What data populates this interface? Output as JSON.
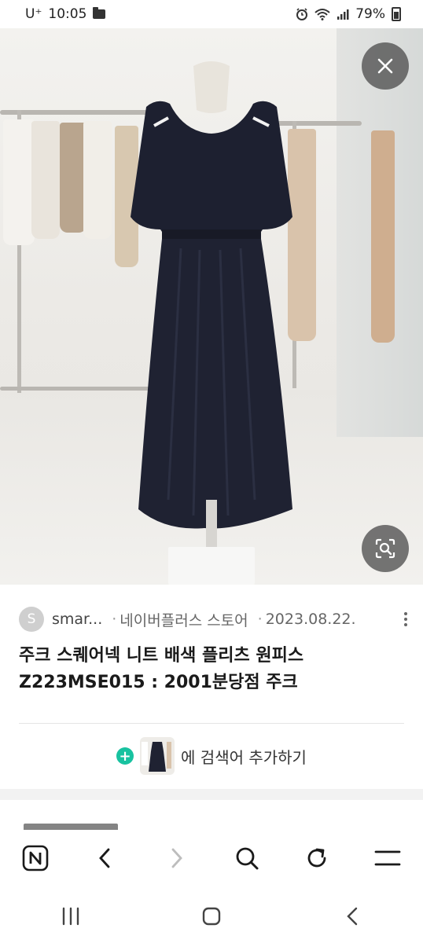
{
  "status_bar": {
    "carrier": "U⁺",
    "time": "10:05",
    "battery": "79%",
    "icons": [
      "folder-icon",
      "alarm-icon",
      "wifi-icon",
      "signal-icon",
      "battery-icon"
    ]
  },
  "image_viewer": {
    "close_icon": "close-icon",
    "lens_icon": "lens-search-icon"
  },
  "result": {
    "site_initial": "S",
    "site_name": "smar...",
    "separator": "·",
    "store_name": "네이버플러스 스토어",
    "date": "2023.08.22.",
    "title": "주크 스퀘어넥 니트 배색 플리츠 원피스 Z223MSE015 : 2001분당점 주크",
    "add_search_label": "에 검색어 추가하기"
  },
  "browser_toolbar": {
    "items": [
      "naver-home-icon",
      "back-icon",
      "forward-icon",
      "search-icon",
      "refresh-icon",
      "menu-icon"
    ]
  },
  "android_nav": {
    "items": [
      "recents-icon",
      "home-icon",
      "back-icon"
    ]
  },
  "colors": {
    "accent_green": "#18c2a0",
    "dress": "#1f2230",
    "overlay_button": "#505050"
  }
}
